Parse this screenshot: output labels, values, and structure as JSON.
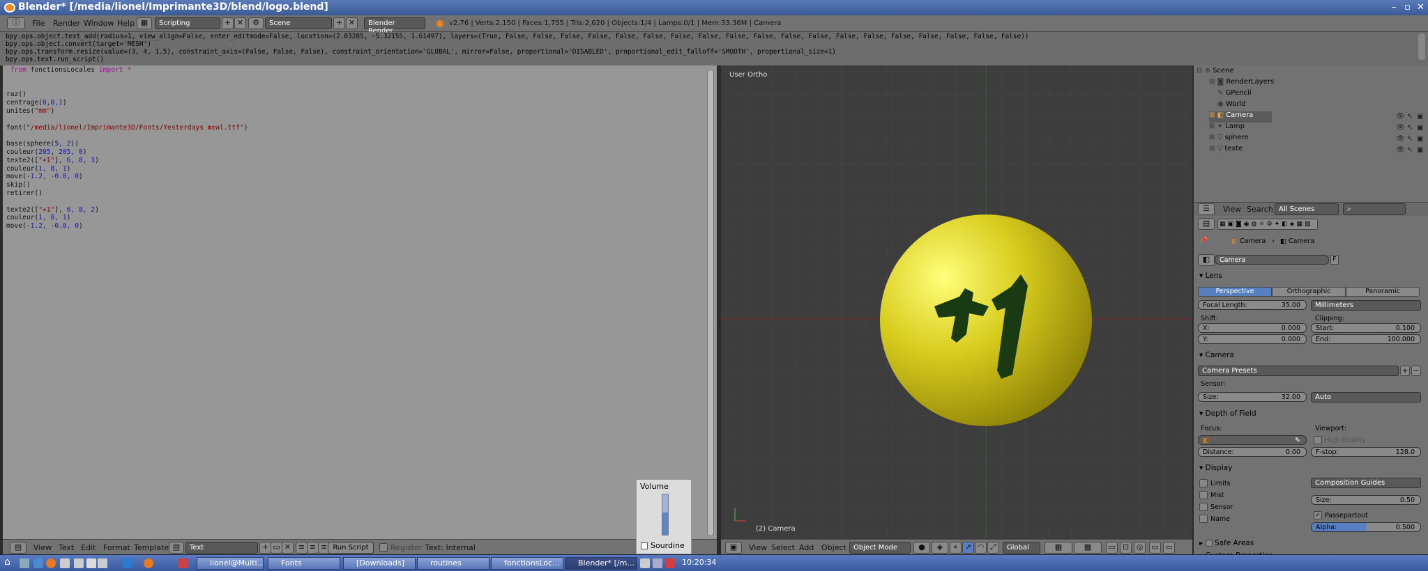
{
  "window": {
    "title": "Blender* [/media/lionel/Imprimante3D/blend/logo.blend]"
  },
  "menubar": {
    "menus": [
      "File",
      "Render",
      "Window",
      "Help"
    ],
    "layout": "Scripting",
    "scene": "Scene",
    "engine": "Blender Render",
    "stats": "v2.76 | Verts:2,150 | Faces:1,755 | Tris:2,620 | Objects:1/4 | Lamps:0/1 | Mem:33.36M | Camera"
  },
  "info_lines": [
    "bpy.ops.object.text_add(radius=1, view_align=False, enter_editmode=False, location=(2.03285, -5.32155, 1.61497), layers=(True, False, False, False, False, False, False, False, False, False, False, False, False, False, False, False, False, False, False, False))",
    "bpy.ops.object.convert(target='MESH')",
    "bpy.ops.transform.resize(value=(3, 4, 1.5), constraint_axis=(False, False, False), constraint_orientation='GLOBAL', mirror=False, proportional='DISABLED', proportional_edit_falloff='SMOOTH', proportional_size=1)",
    "bpy.ops.text.run_script()"
  ],
  "code": {
    "line1_kw1": "from",
    "line1_mod": "fonctionsLocales",
    "line1_kw2": "import",
    "line1_star": "*",
    "l_raz": "raz()",
    "l_centrage_a": "centrage(",
    "l_centrage_n": "0,0,1",
    "l_centrage_b": ")",
    "l_unites_a": "unites(",
    "l_unites_s": "\"mm\"",
    "l_unites_b": ")",
    "l_font_a": "font(",
    "l_font_s": "\"/media/lionel/Imprimante3D/Fonts/Yesterdays meal.ttf\"",
    "l_font_b": ")",
    "l_base_a": "base(sphere(",
    "l_base_n": "5, 2",
    "l_base_b": "))",
    "l_coul1_a": "couleur(",
    "l_coul1_n": "205, 205, 0",
    "l_coul1_b": ")",
    "l_texte_a": "texte2([",
    "l_texte_s": "\"+1\"",
    "l_texte_b": "], ",
    "l_texte_n": "6, 8, 3",
    "l_texte_c": ")",
    "l_coul2_a": "couleur(",
    "l_coul2_n": "1, 8, 1",
    "l_coul2_b": ")",
    "l_move_a": "move(",
    "l_move_n": "-1.2, -0.8, 0",
    "l_move_b": ")",
    "l_skip": "skip()",
    "l_retirer": "retirer()",
    "l_texte2_a": "texte2([",
    "l_texte2_s": "\"+1\"",
    "l_texte2_b": "], ",
    "l_texte2_n": "6, 8, 2",
    "l_texte2_c": ")",
    "l_coul3_a": "couleur(",
    "l_coul3_n": "1, 8, 1",
    "l_coul3_b": ")",
    "l_move2_a": "move(",
    "l_move2_n": "-1.2, -0.8, 0",
    "l_move2_b": ")"
  },
  "editor_footer": {
    "menus": [
      "View",
      "Text",
      "Edit",
      "Format",
      "Templates"
    ],
    "text_name": "Text",
    "run": "Run Script",
    "register": "Register",
    "internal": "Text: Internal"
  },
  "volume": {
    "title": "Volume",
    "mute": "Sourdine",
    "level": 0.55
  },
  "viewport": {
    "label": "User Ortho",
    "object_label": "(2) Camera",
    "sphere_color": "#d8cc1e",
    "glyph": "+1",
    "footer": {
      "menus": [
        "View",
        "Select",
        "Add",
        "Object"
      ],
      "mode": "Object Mode",
      "orientation": "Global"
    }
  },
  "outliner": {
    "items": [
      {
        "label": "Scene"
      },
      {
        "label": "RenderLayers"
      },
      {
        "label": "GPencil"
      },
      {
        "label": "World"
      },
      {
        "label": "Camera"
      },
      {
        "label": "Lamp"
      },
      {
        "label": "sphere"
      },
      {
        "label": "texte"
      }
    ],
    "header": {
      "view": "View",
      "search": "Search",
      "filter": "All Scenes"
    }
  },
  "properties": {
    "breadcrumb": [
      "Camera",
      "Camera"
    ],
    "datablock": "Camera",
    "fake": "F",
    "lens": {
      "title": "Lens",
      "tabs": [
        "Perspective",
        "Orthographic",
        "Panoramic"
      ],
      "focal_label": "Focal Length:",
      "focal_value": "35.00",
      "unit": "Millimeters",
      "shift": "Shift:",
      "clipping": "Clipping:",
      "x_label": "X:",
      "x_value": "0.000",
      "y_label": "Y:",
      "y_value": "0.000",
      "start_label": "Start:",
      "start_value": "0.100",
      "end_label": "End:",
      "end_value": "100.000"
    },
    "camera": {
      "title": "Camera",
      "presets": "Camera Presets",
      "sensor": "Sensor:",
      "size_label": "Size:",
      "size_value": "32.00",
      "fit": "Auto"
    },
    "dof": {
      "title": "Depth of Field",
      "focus": "Focus:",
      "viewport": "Viewport:",
      "hq": "High Quality",
      "distance_label": "Distance:",
      "distance_value": "0.00",
      "fstop_label": "F-stop:",
      "fstop_value": "128.0"
    },
    "display": {
      "title": "Display",
      "limits": "Limits",
      "mist": "Mist",
      "sensor": "Sensor",
      "name": "Name",
      "guides": "Composition Guides",
      "size_label": "Size:",
      "size_value": "0.50",
      "passepartout": "Passepartout",
      "alpha_label": "Alpha:",
      "alpha_value": "0.500"
    },
    "safe_areas": "Safe Areas",
    "custom": "Custom Properties"
  },
  "taskbar": {
    "tasks": [
      "lionel@Multi...",
      "Fonts",
      "[Downloads]",
      "routines",
      "fonctionsLoc...",
      "Blender* [/m..."
    ],
    "clock": "10:20:34"
  }
}
